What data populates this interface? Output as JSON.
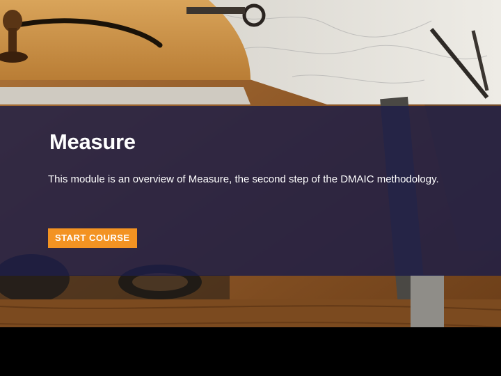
{
  "module": {
    "title": "Measure",
    "description": "This module is an overview of Measure, the second step of the DMAIC methodology.",
    "start_label": "START COURSE"
  },
  "colors": {
    "overlay": "#1e1e46",
    "button": "#f39322",
    "text": "#ffffff"
  },
  "background": {
    "icon": "drafting-tools-photo"
  }
}
